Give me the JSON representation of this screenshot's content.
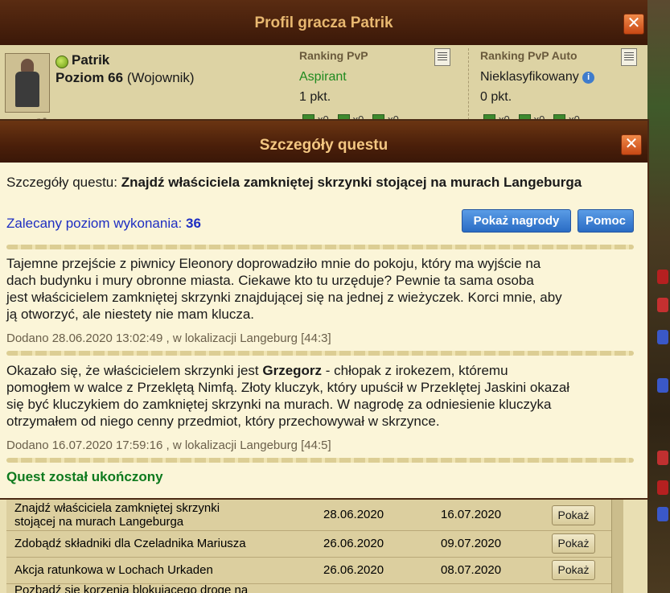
{
  "profile": {
    "title": "Profil gracza Patrik",
    "player_name": "Patrik",
    "level_label": "Poziom 66",
    "class_label": "(Wojownik)",
    "ranking_pvp": {
      "title": "Ranking PvP",
      "value": "Aspirant",
      "value_color": "#1f8a1f",
      "points": "1 pkt."
    },
    "ranking_pvp_auto": {
      "title": "Ranking PvP Auto",
      "value": "Nieklasyfikowany",
      "value_color": "#1a1a1a",
      "points": "0 pkt."
    },
    "medal_count": "x0"
  },
  "quest_table": {
    "rows": [
      {
        "name": "Znajdź właściciela zamkniętej skrzynki stojącej na murach Langeburga",
        "start": "28.06.2020",
        "end": "16.07.2020",
        "button": "Pokaż"
      },
      {
        "name": "Zdobądź składniki dla Czeladnika Mariusza",
        "start": "26.06.2020",
        "end": "09.07.2020",
        "button": "Pokaż"
      },
      {
        "name": "Akcja ratunkowa w Lochach Urkaden",
        "start": "26.06.2020",
        "end": "08.07.2020",
        "button": "Pokaż"
      },
      {
        "name": "Pozbądź się korzenia blokującego drogę na",
        "start": "",
        "end": "",
        "button": ""
      }
    ]
  },
  "modal": {
    "title": "Szczegóły questu",
    "details_prefix": "Szczegóły questu: ",
    "quest_name": "Znajdź właściciela zamkniętej skrzynki stojącej na murach Langeburga",
    "recommended_label": "Zalecany poziom wykonania: ",
    "recommended_level": "36",
    "show_rewards_button": "Pokaż nagrody",
    "help_button": "Pomoc",
    "entries": [
      {
        "text_lines": [
          "Tajemne przejście z piwnicy Eleonory doprowadziło mnie do pokoju, który ma wyjście na",
          "dach budynku i mury obronne miasta. Ciekawe kto tu urzęduje? Pewnie ta sama osoba",
          "jest właścicielem zamkniętej skrzynki znajdującej się na jednej z wieżyczek. Korci mnie, aby",
          "ją otworzyć, ale niestety nie mam klucza."
        ],
        "meta": "Dodano 28.06.2020 13:02:49 , w lokalizacji Langeburg [44:3]"
      },
      {
        "line1_prefix": "Okazało się, że właścicielem skrzynki jest ",
        "line1_bold": "Grzegorz",
        "line1_suffix": " - chłopak z irokezem, któremu",
        "text_lines": [
          "pomogłem w walce z Przeklętą Nimfą. Złoty kluczyk, który upuścił w Przeklętej Jaskini okazał",
          "się być kluczykiem do zamkniętej skrzynki na murach. W nagrodę za odniesienie kluczyka",
          "otrzymałem od niego cenny przedmiot, który przechowywał w skrzynce."
        ],
        "meta": "Dodano 16.07.2020 17:59:16 , w lokalizacji Langeburg [44:5]"
      }
    ],
    "status": "Quest został ukończony"
  },
  "colors": {
    "header_bg": "#4a1f0a",
    "header_text": "#f3c782",
    "modal_bg": "#fbf5d8",
    "link_blue": "#1e2ec2",
    "button_blue": "#2a6cc4",
    "success_green": "#0e7a1e",
    "close_orange": "#e0682c"
  }
}
